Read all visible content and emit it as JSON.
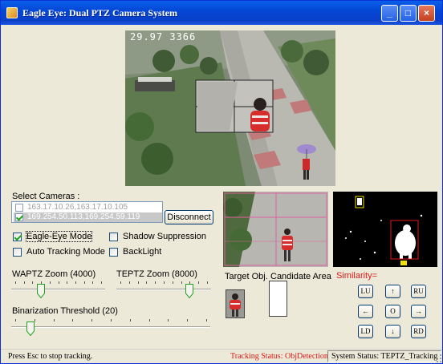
{
  "window": {
    "title": "Eagle Eye: Dual PTZ Camera System",
    "minimize_glyph": "_",
    "maximize_glyph": "□",
    "close_glyph": "×"
  },
  "main_video": {
    "osd_text": "29.97  3366"
  },
  "cameras": {
    "label": "Select Cameras :",
    "items": [
      {
        "text": "163.17.10.26,163.17.10.105",
        "checked": false
      },
      {
        "text": "169.254.50.113,169.254.59.119",
        "checked": true
      }
    ],
    "disconnect_label": "Disconnect"
  },
  "options": {
    "eagle_eye_mode": {
      "label": "Eagle-Eye Mode",
      "checked": true
    },
    "shadow_suppression": {
      "label": "Shadow Suppression",
      "checked": false
    },
    "auto_tracking_mode": {
      "label": "Auto Tracking Mode",
      "checked": false
    },
    "backlight": {
      "label": "BackLight",
      "checked": false
    }
  },
  "sliders": {
    "waptz": {
      "label": "WAPTZ Zoom (4000)",
      "value": 4000,
      "fraction": 0.3
    },
    "teptz": {
      "label": "TEPTZ Zoom (8000)",
      "value": 8000,
      "fraction": 0.8
    },
    "binarization": {
      "label": "Binarization Threshold (20)",
      "value": 20,
      "fraction": 0.08
    }
  },
  "target": {
    "target_label": "Target Obj.",
    "candidate_label": "Candidate Area",
    "similarity_label": "Similarity="
  },
  "ptz": {
    "lu": "LU",
    "up": "↑",
    "ru": "RU",
    "left": "←",
    "center": "O",
    "right": "→",
    "ld": "LD",
    "down": "↓",
    "rd": "RD"
  },
  "status": {
    "hint": "Press Esc to stop tracking.",
    "tracking": "Tracking Status:   ObjDetection",
    "system": "System Status:   TEPTZ_Tracking"
  },
  "colors": {
    "titlebar": "#0348d6",
    "status_red": "#e01818",
    "window_bg": "#ece9d8"
  }
}
